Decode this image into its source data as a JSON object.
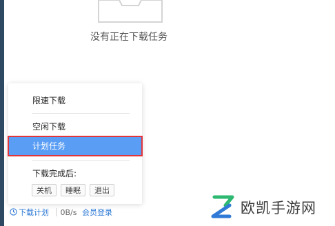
{
  "empty_state": {
    "message": "没有正在下载任务",
    "icon": "empty-box-icon"
  },
  "menu": {
    "items": [
      {
        "label": "限速下载"
      },
      {
        "label": "空闲下载"
      },
      {
        "label": "计划任务",
        "selected": true
      }
    ],
    "after_download_label": "下载完成后:",
    "after_download_options": [
      "关机",
      "睡眠",
      "退出"
    ]
  },
  "status_bar": {
    "schedule_label": "下载计划",
    "speed": "0B/s",
    "login_label": "会员登录",
    "icon": "clock-icon"
  },
  "watermark": {
    "text": "欧凯手游网",
    "icon": "brand-logo-icon"
  },
  "colors": {
    "selected_bg": "#5a9df5",
    "highlight_border": "#e2353a",
    "link": "#2f7ad6",
    "logo_green": "#2eb872",
    "logo_blue": "#2f7ad6"
  }
}
